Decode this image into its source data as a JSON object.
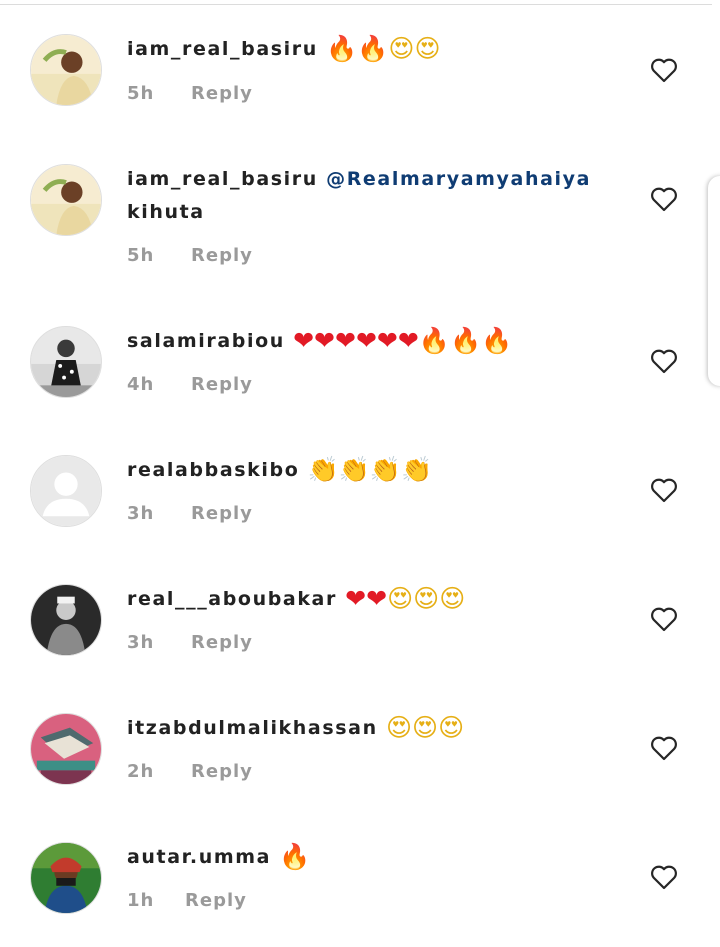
{
  "comments": [
    {
      "username": "iam_real_basiru",
      "mention": "",
      "text": "",
      "emojis": [
        {
          "glyph": "🔥",
          "kind": "fire"
        },
        {
          "glyph": "🔥",
          "kind": "fire"
        },
        {
          "glyph": "😍",
          "kind": "love"
        },
        {
          "glyph": "😍",
          "kind": "love"
        }
      ],
      "time": "5h",
      "reply": "Reply",
      "avatar": "person-photo-icon"
    },
    {
      "username": "iam_real_basiru",
      "mention": "@Realmaryamyahaiya",
      "text": "kihuta",
      "emojis": [],
      "time": "5h",
      "reply": "Reply",
      "avatar": "person-photo-icon"
    },
    {
      "username": "salamirabiou",
      "mention": "",
      "text": "",
      "emojis": [
        {
          "glyph": "❤",
          "kind": "red"
        },
        {
          "glyph": "❤",
          "kind": "red"
        },
        {
          "glyph": "❤",
          "kind": "red"
        },
        {
          "glyph": "❤",
          "kind": "red"
        },
        {
          "glyph": "❤",
          "kind": "red"
        },
        {
          "glyph": "❤",
          "kind": "red"
        },
        {
          "glyph": "🔥",
          "kind": "fire"
        },
        {
          "glyph": "🔥",
          "kind": "fire"
        },
        {
          "glyph": "🔥",
          "kind": "fire"
        }
      ],
      "time": "4h",
      "reply": "Reply",
      "avatar": "person-photo-icon"
    },
    {
      "username": "realabbaskibo",
      "mention": "",
      "text": "",
      "emojis": [
        {
          "glyph": "👏",
          "kind": "clap"
        },
        {
          "glyph": "👏",
          "kind": "clap"
        },
        {
          "glyph": "👏",
          "kind": "clap"
        },
        {
          "glyph": "👏",
          "kind": "clap"
        }
      ],
      "time": "3h",
      "reply": "Reply",
      "avatar": "default-avatar-icon"
    },
    {
      "username": "real___aboubakar",
      "mention": "",
      "text": "",
      "emojis": [
        {
          "glyph": "❤",
          "kind": "red"
        },
        {
          "glyph": "❤",
          "kind": "red"
        },
        {
          "glyph": "😍",
          "kind": "love"
        },
        {
          "glyph": "😍",
          "kind": "love"
        },
        {
          "glyph": "😍",
          "kind": "love"
        }
      ],
      "time": "3h",
      "reply": "Reply",
      "avatar": "person-photo-icon"
    },
    {
      "username": "itzabdulmalikhassan",
      "mention": "",
      "text": "",
      "emojis": [
        {
          "glyph": "😍",
          "kind": "love"
        },
        {
          "glyph": "😍",
          "kind": "love"
        },
        {
          "glyph": "😍",
          "kind": "love"
        }
      ],
      "time": "2h",
      "reply": "Reply",
      "avatar": "book-photo-icon"
    },
    {
      "username": "autar.umma",
      "mention": "",
      "text": "",
      "emojis": [
        {
          "glyph": "🔥",
          "kind": "fire"
        }
      ],
      "time": "1h",
      "reply": "Reply",
      "avatar": "person-photo-icon"
    }
  ],
  "like_icon": "heart-outline-icon",
  "colors": {
    "username": "#222222",
    "mention": "#0f3c73",
    "meta": "#9a9a9a",
    "heart": "#262626"
  }
}
